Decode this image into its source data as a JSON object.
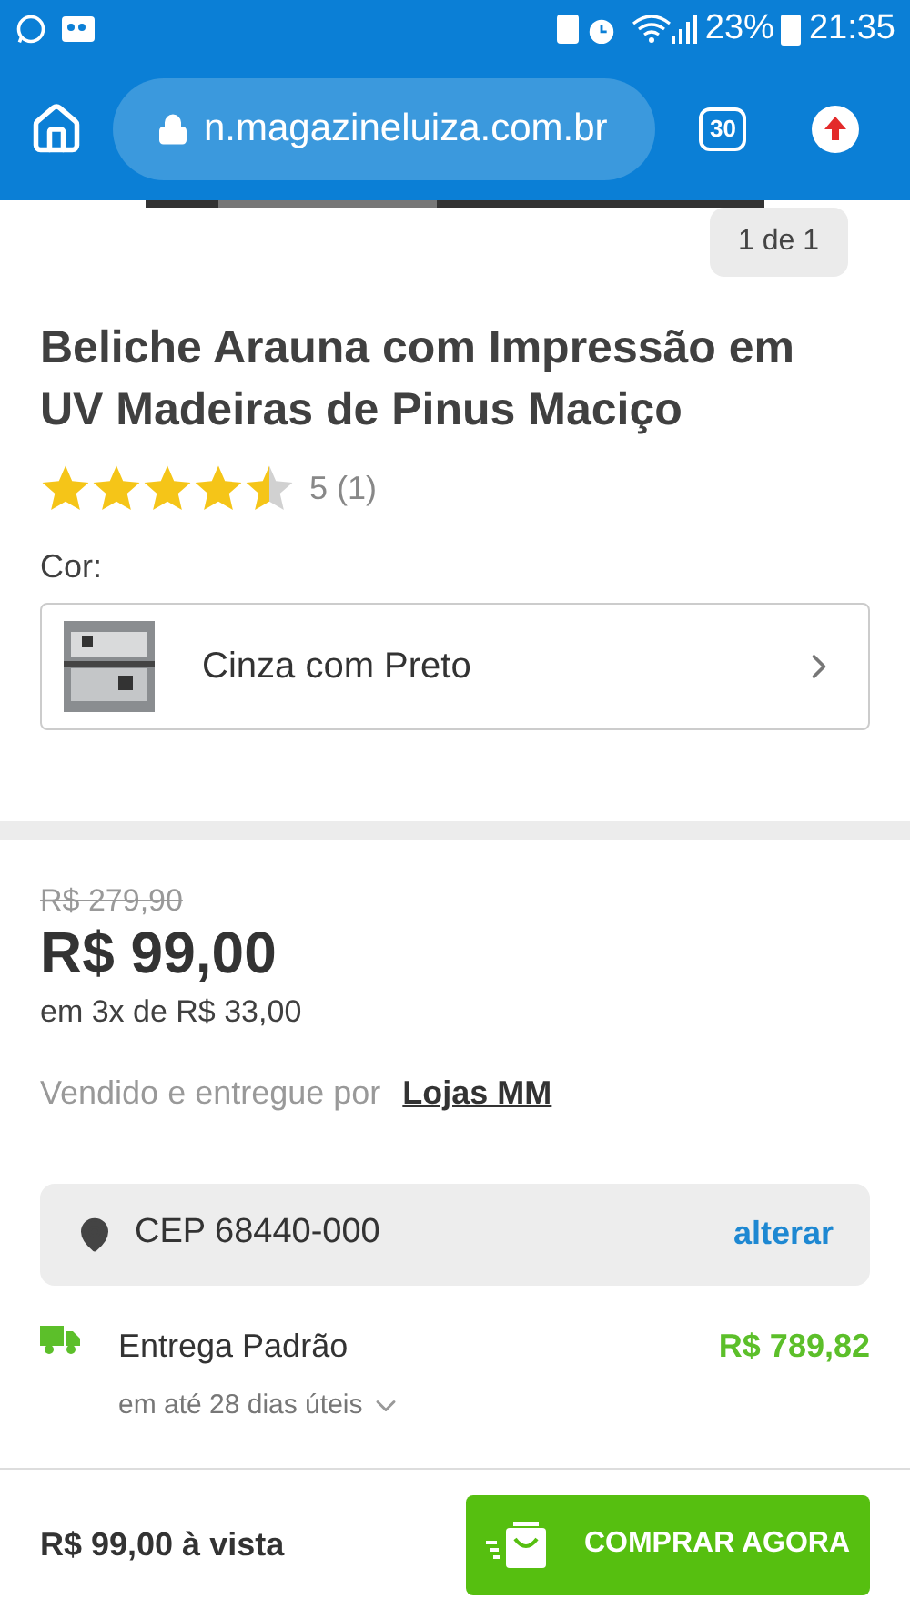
{
  "status_bar": {
    "battery": "23%",
    "time": "21:35"
  },
  "browser": {
    "url": "n.magazineluiza.com.br",
    "tab_count": "30"
  },
  "gallery": {
    "counter": "1 de 1"
  },
  "product": {
    "title": "Beliche Arauna com Impressão em UV Madeiras de Pinus Maciço",
    "stars": 4.5,
    "rating": "5 (1)"
  },
  "color": {
    "label": "Cor:",
    "value": "Cinza com Preto"
  },
  "price": {
    "old": "R$ 279,90",
    "current": "R$ 99,00",
    "installments": "em 3x de R$ 33,00",
    "seller_label": "Vendido e entregue por",
    "seller": "Lojas MM"
  },
  "shipping": {
    "cep": "CEP 68440-000",
    "change": "alterar",
    "method": "Entrega Padrão",
    "cost": "R$ 789,82",
    "eta": "em até 28 dias úteis"
  },
  "bottom_bar": {
    "price": "R$ 99,00 à vista",
    "button": "COMPRAR AGORA"
  }
}
